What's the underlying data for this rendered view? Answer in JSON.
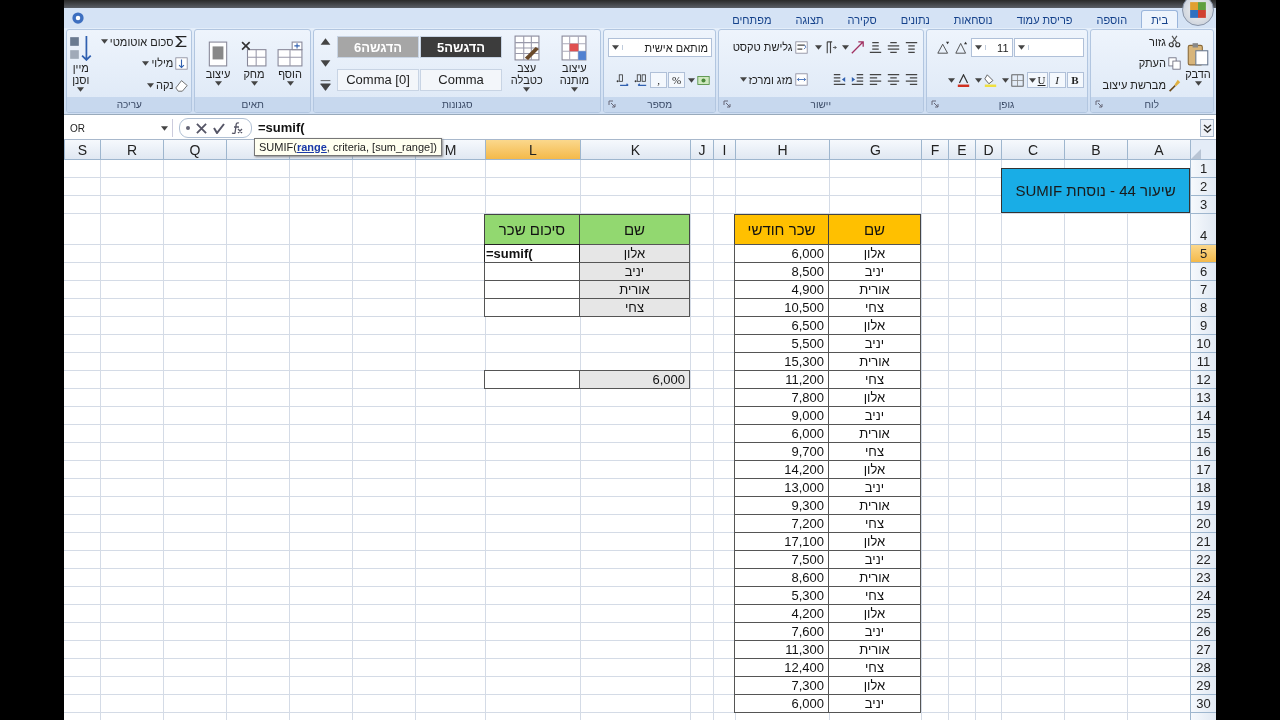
{
  "ribbon": {
    "tabs": [
      {
        "label": "בית",
        "selected": true
      },
      {
        "label": "הוספה",
        "selected": false
      },
      {
        "label": "פריסת עמוד",
        "selected": false
      },
      {
        "label": "נוסחאות",
        "selected": false
      },
      {
        "label": "נתונים",
        "selected": false
      },
      {
        "label": "סקירה",
        "selected": false
      },
      {
        "label": "תצוגה",
        "selected": false
      },
      {
        "label": "מפתחים",
        "selected": false
      }
    ],
    "groups": [
      {
        "title": "לוח",
        "launcher": true,
        "columns": [
          [
            [
              {
                "kind": "paste",
                "label": "הדבק",
                "menu": true
              }
            ]
          ],
          [
            [
              {
                "kind": "cut",
                "label": "גזור"
              }
            ],
            [
              {
                "kind": "copy",
                "label": "העתק"
              }
            ],
            [
              {
                "kind": "brush",
                "label": "מברשת עיצוב"
              }
            ]
          ]
        ]
      },
      {
        "title": "גופן",
        "launcher": true,
        "columns": [
          [
            [
              {
                "kind": "combo",
                "menu": true
              },
              {
                "kind": "combo",
                "label": "11",
                "menu": true
              },
              {
                "kind": "grow"
              },
              {
                "kind": "shrink"
              }
            ],
            [
              {
                "kind": "bold",
                "label": "B"
              },
              {
                "kind": "italic",
                "label": "I"
              },
              {
                "kind": "underline",
                "label": "U",
                "menu": true
              },
              {
                "kind": "borders",
                "menu": true
              },
              {
                "kind": "fill",
                "menu": true
              },
              {
                "kind": "fontcolor",
                "menu": true
              }
            ]
          ]
        ]
      },
      {
        "title": "יישור",
        "launcher": true,
        "columns": [
          [
            [
              {
                "kind": "align_top"
              },
              {
                "kind": "align_middle"
              },
              {
                "kind": "align_bottom"
              },
              {
                "kind": "orientation",
                "menu": true
              },
              {
                "kind": "direction",
                "menu": true
              }
            ],
            [
              {
                "kind": "align_right"
              },
              {
                "kind": "align_center"
              },
              {
                "kind": "align_left"
              },
              {
                "kind": "outdent"
              },
              {
                "kind": "indent"
              }
            ]
          ],
          [
            [
              {
                "kind": "wrap",
                "label": "גלישת טקסט"
              }
            ],
            [
              {
                "kind": "merge",
                "label": "מזג ומרכז",
                "menu": true
              }
            ]
          ]
        ]
      },
      {
        "title": "מספר",
        "launcher": true,
        "columns": [
          [
            [
              {
                "kind": "combo",
                "label": "מותאם אישית",
                "menu": true
              }
            ],
            [
              {
                "kind": "currency",
                "menu": true
              },
              {
                "kind": "percent",
                "label": "%"
              },
              {
                "kind": "comma",
                "label": ","
              },
              {
                "kind": "decimal_more"
              },
              {
                "kind": "decimal_less"
              }
            ]
          ]
        ]
      },
      {
        "title": "סגנונות",
        "launcher": false,
        "columns": [
          [
            [
              {
                "kind": "conditional",
                "label": "עיצוב מותנה",
                "menu": true
              }
            ]
          ],
          [
            [
              {
                "kind": "table",
                "label": "עצב כטבלה",
                "menu": true
              }
            ]
          ],
          [
            [
              {
                "kind": "style",
                "label": "הדגשה5",
                "color": "#3c3c3c"
              },
              {
                "kind": "style",
                "label": "הדגשה6",
                "color": "#a6a6a6"
              }
            ],
            [
              {
                "kind": "style",
                "label": "Comma",
                "color": "#f3f6fa"
              },
              {
                "kind": "style",
                "label": "Comma [0]",
                "color": "#f3f6fa"
              }
            ]
          ],
          [
            [
              {
                "kind": "scroll_up"
              }
            ],
            [
              {
                "kind": "scroll_down"
              }
            ],
            [
              {
                "kind": "more"
              }
            ]
          ]
        ]
      },
      {
        "title": "תאים",
        "launcher": false,
        "columns": [
          [
            [
              {
                "kind": "insert_cells",
                "label": "הוסף",
                "menu": true
              }
            ]
          ],
          [
            [
              {
                "kind": "delete_cells",
                "label": "מחק",
                "menu": true
              }
            ]
          ],
          [
            [
              {
                "kind": "format_cells",
                "label": "עיצוב",
                "menu": true
              }
            ]
          ]
        ]
      },
      {
        "title": "עריכה",
        "launcher": false,
        "columns": [
          [
            [
              {
                "kind": "sum",
                "label": "סכום אוטומטי",
                "menu": true
              }
            ],
            [
              {
                "kind": "fill_down",
                "label": "מילוי",
                "menu": true
              }
            ],
            [
              {
                "kind": "clear",
                "label": "נקה",
                "menu": true
              }
            ]
          ],
          [
            [
              {
                "kind": "sort",
                "label": "מיין וסנן",
                "menu": true
              }
            ]
          ]
        ]
      }
    ]
  },
  "formula_bar": {
    "name_box": "OR",
    "formula": "=sumif("
  },
  "tooltip": {
    "text": "SUMIF(**range**, criteria, [sum_range])"
  },
  "sheet": {
    "columns": [
      {
        "label": "A",
        "selected": false
      },
      {
        "label": "B",
        "selected": false
      },
      {
        "label": "C",
        "selected": false
      },
      {
        "label": "D",
        "selected": false
      },
      {
        "label": "E",
        "selected": false
      },
      {
        "label": "F",
        "selected": false
      },
      {
        "label": "G",
        "selected": false
      },
      {
        "label": "H",
        "selected": false
      },
      {
        "label": "I",
        "selected": false
      },
      {
        "label": "J",
        "selected": false
      },
      {
        "label": "K",
        "selected": false
      },
      {
        "label": "L",
        "selected": true
      },
      {
        "label": "M",
        "selected": false
      },
      {
        "selected": false
      },
      {
        "selected": false
      },
      {
        "selected": false
      },
      {
        "label": "Q",
        "selected": false
      },
      {
        "label": "R",
        "selected": false
      },
      {
        "label": "S",
        "selected": false
      }
    ],
    "rows": [
      {
        "label": "1",
        "selected": false
      },
      {
        "label": "2",
        "selected": false
      },
      {
        "label": "3",
        "selected": false
      },
      {
        "label": "4",
        "selected": false
      },
      {
        "label": "5",
        "selected": true
      },
      {
        "label": "6",
        "selected": false
      },
      {
        "label": "7",
        "selected": false
      },
      {
        "label": "8",
        "selected": false
      },
      {
        "label": "9",
        "selected": false
      },
      {
        "label": "10",
        "selected": false
      },
      {
        "label": "11",
        "selected": false
      },
      {
        "label": "12",
        "selected": false
      },
      {
        "label": "13",
        "selected": false
      },
      {
        "label": "14",
        "selected": false
      },
      {
        "label": "15",
        "selected": false
      },
      {
        "label": "16",
        "selected": false
      },
      {
        "label": "17",
        "selected": false
      },
      {
        "label": "18",
        "selected": false
      },
      {
        "label": "19",
        "selected": false
      },
      {
        "label": "20",
        "selected": false
      },
      {
        "label": "21",
        "selected": false
      },
      {
        "label": "22",
        "selected": false
      },
      {
        "label": "23",
        "selected": false
      },
      {
        "label": "24",
        "selected": false
      },
      {
        "label": "25",
        "selected": false
      },
      {
        "label": "26",
        "selected": false
      },
      {
        "label": "27",
        "selected": false
      },
      {
        "label": "28",
        "selected": false
      },
      {
        "label": "29",
        "selected": false
      },
      {
        "label": "30",
        "selected": false
      },
      {
        "selected": false
      }
    ],
    "title_banner": {
      "text": "שיעור 44 - נוסחת SUMIF"
    },
    "tables": [
      {
        "kind": "source",
        "color": "#ffc000",
        "columns": [
          "שם",
          "שכר חודשי"
        ],
        "rows": [
          [
            "אלון",
            "6,000"
          ],
          [
            "יניב",
            "8,500"
          ],
          [
            "אורית",
            "4,900"
          ],
          [
            "צחי",
            "10,500"
          ],
          [
            "אלון",
            "6,500"
          ],
          [
            "יניב",
            "5,500"
          ],
          [
            "אורית",
            "15,300"
          ],
          [
            "צחי",
            "11,200"
          ],
          [
            "אלון",
            "7,800"
          ],
          [
            "יניב",
            "9,000"
          ],
          [
            "אורית",
            "6,000"
          ],
          [
            "צחי",
            "9,700"
          ],
          [
            "אלון",
            "14,200"
          ],
          [
            "יניב",
            "13,000"
          ],
          [
            "אורית",
            "9,300"
          ],
          [
            "צחי",
            "7,200"
          ],
          [
            "אלון",
            "17,100"
          ],
          [
            "יניב",
            "7,500"
          ],
          [
            "אורית",
            "8,600"
          ],
          [
            "צחי",
            "5,300"
          ],
          [
            "אלון",
            "4,200"
          ],
          [
            "יניב",
            "7,600"
          ],
          [
            "אורית",
            "11,300"
          ],
          [
            "צחי",
            "12,400"
          ],
          [
            "אלון",
            "7,300"
          ],
          [
            "יניב",
            "6,000"
          ]
        ]
      },
      {
        "kind": "lookup",
        "color": "#92d870",
        "columns": [
          "שם",
          "סיכום שכר"
        ],
        "rows": [
          {
            "cells": [
              "אלון",
              "=sumif("
            ],
            "editing": true
          },
          {
            "cells": [
              "יניב"
            ],
            "editing": false
          },
          {
            "cells": [
              "אורית"
            ],
            "editing": false
          },
          {
            "cells": [
              "צחי"
            ],
            "editing": false
          }
        ]
      }
    ],
    "check_row": {
      "cells": [
        "6,000"
      ]
    }
  }
}
